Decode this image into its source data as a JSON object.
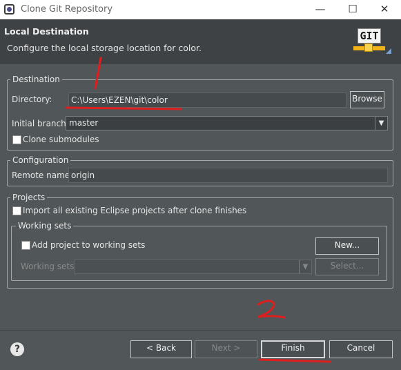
{
  "window": {
    "title": "Clone Git Repository",
    "minimize": "—",
    "maximize": "☐",
    "close": "✕"
  },
  "header": {
    "title": "Local Destination",
    "description": "Configure the local storage location for color.",
    "logo_text": "GIT"
  },
  "destination": {
    "group_label": "Destination",
    "directory_label": "Directory:",
    "directory_value": "C:\\Users\\EZEN\\git\\color",
    "browse_label": "Browse",
    "branch_label": "Initial branch:",
    "branch_value": "master",
    "clone_submodules_label": "Clone submodules",
    "clone_submodules_checked": false
  },
  "configuration": {
    "group_label": "Configuration",
    "remote_label": "Remote name:",
    "remote_value": "origin"
  },
  "projects": {
    "group_label": "Projects",
    "import_label": "Import all existing Eclipse projects after clone finishes",
    "import_checked": false,
    "working_sets_group_label": "Working sets",
    "add_project_label": "Add project to working sets",
    "add_project_checked": false,
    "new_label": "New...",
    "working_sets_label": "Working sets:",
    "working_sets_value": "",
    "select_label": "Select..."
  },
  "footer": {
    "help_icon": "?",
    "back_label": "< Back",
    "next_label": "Next >",
    "finish_label": "Finish",
    "cancel_label": "Cancel"
  },
  "annotation": {
    "step_number": "2",
    "color": "#e01e1e"
  }
}
